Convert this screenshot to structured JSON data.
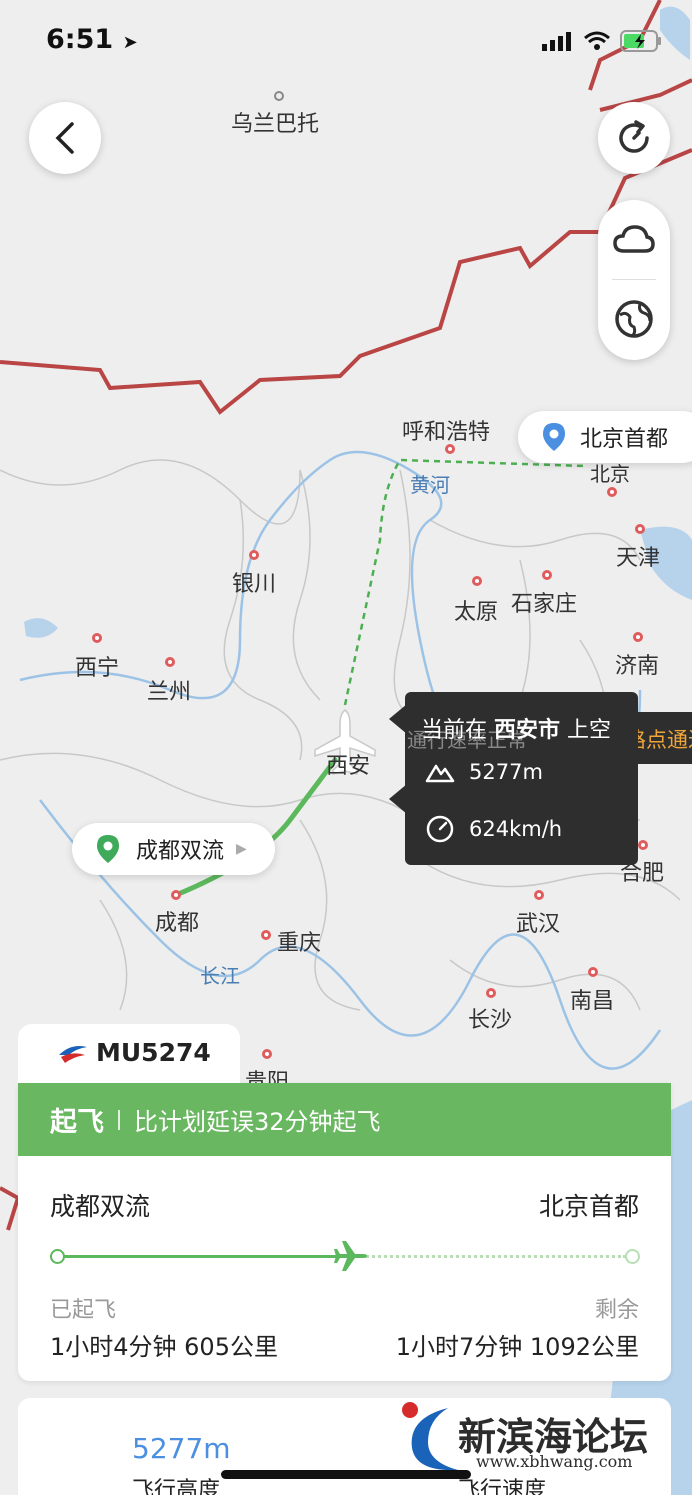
{
  "status_bar": {
    "time": "6:51"
  },
  "map": {
    "cities": [
      {
        "name": "乌兰巴托"
      },
      {
        "name": "呼和浩特"
      },
      {
        "name": "银川"
      },
      {
        "name": "太原"
      },
      {
        "name": "石家庄"
      },
      {
        "name": "天津"
      },
      {
        "name": "西宁"
      },
      {
        "name": "兰州"
      },
      {
        "name": "济南"
      },
      {
        "name": "西安"
      },
      {
        "name": "合肥"
      },
      {
        "name": "成都"
      },
      {
        "name": "重庆"
      },
      {
        "name": "武汉"
      },
      {
        "name": "南昌"
      },
      {
        "name": "长沙"
      },
      {
        "name": "贵阳"
      }
    ],
    "rivers": [
      {
        "name": "黄河"
      },
      {
        "name": "长江"
      }
    ],
    "origin_pill": "成都双流",
    "destination_pill": "北京首都",
    "beijing_label": "北京",
    "tooltip": {
      "location_prefix": "当前在",
      "location_city": "西安市",
      "location_suffix": "上空",
      "altitude": "5277m",
      "speed": "624km/h"
    },
    "behind_text": "通行速率正常",
    "ticker_text": "以航路点通过航"
  },
  "flight": {
    "number": "MU5274",
    "status": "起飞",
    "status_detail": "比计划延误32分钟起飞",
    "origin": "成都双流",
    "destination": "北京首都",
    "progress": 0.51,
    "elapsed_label": "已起飞",
    "elapsed_value": "1小时4分钟 605公里",
    "remaining_label": "剩余",
    "remaining_value": "1小时7分钟 1092公里"
  },
  "bottom": {
    "altitude_value": "5277m",
    "altitude_label": "飞行高度",
    "speed_label": "飞行速度"
  },
  "watermark": {
    "site_name": "新滨海论坛",
    "site_url": "www.xbhwang.com"
  },
  "colors": {
    "route_green": "#5cb85c",
    "border_red": "#c0392b",
    "banner_green": "#69b760",
    "brand_blue": "#1a63b8",
    "brand_red": "#d62b2b"
  }
}
